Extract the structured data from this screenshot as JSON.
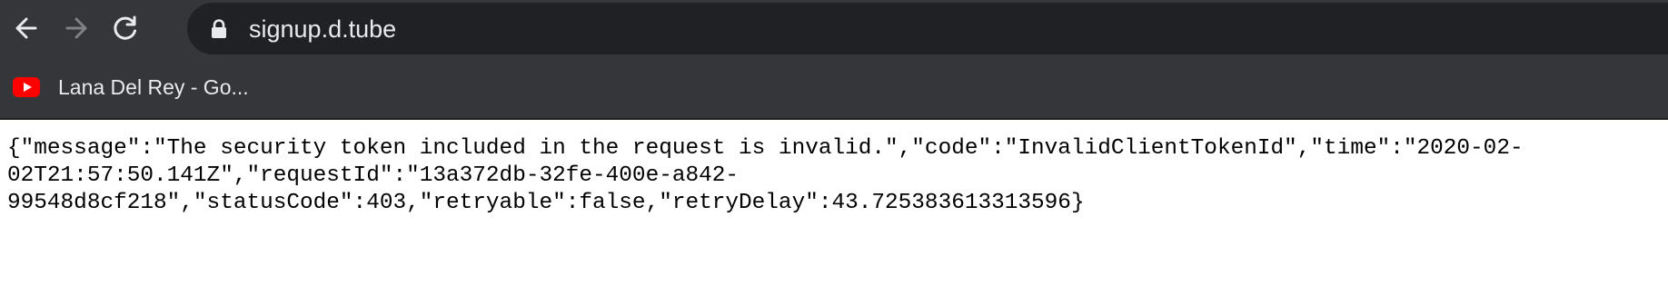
{
  "browser": {
    "address_bar": {
      "url": "signup.d.tube"
    },
    "bookmarks": [
      {
        "label": "Lana Del Rey - Go...",
        "icon": "youtube-icon"
      }
    ],
    "colors": {
      "toolbar": "#35363a",
      "omnibox": "#202124",
      "youtube": "#ff0000"
    }
  },
  "page": {
    "body_text": "{\"message\":\"The security token included in the request is invalid.\",\"code\":\"InvalidClientTokenId\",\"time\":\"2020-02-02T21:57:50.141Z\",\"requestId\":\"13a372db-32fe-400e-a842-99548d8cf218\",\"statusCode\":403,\"retryable\":false,\"retryDelay\":43.725383613313596}"
  }
}
